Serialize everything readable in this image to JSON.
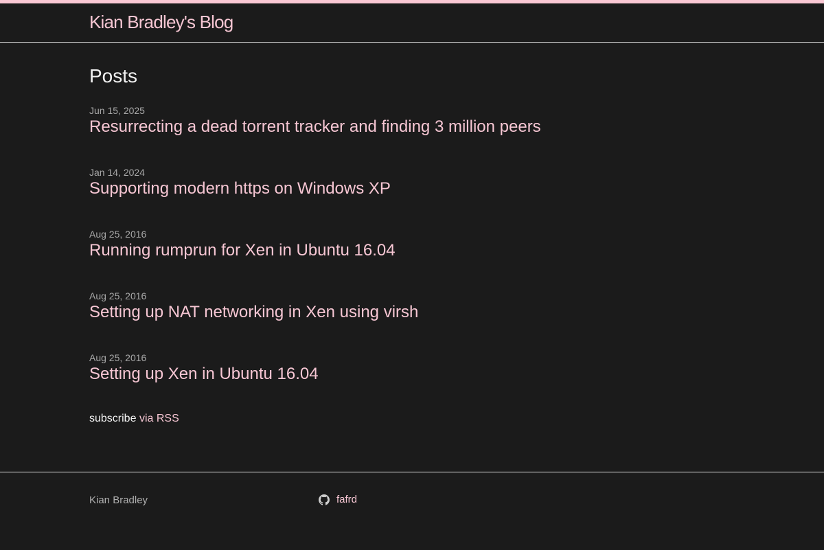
{
  "header": {
    "site_title": "Kian Bradley's Blog"
  },
  "main": {
    "heading": "Posts",
    "posts": [
      {
        "date": "Jun 15, 2025",
        "title": "Resurrecting a dead torrent tracker and finding 3 million peers"
      },
      {
        "date": "Jan 14, 2024",
        "title": "Supporting modern https on Windows XP"
      },
      {
        "date": "Aug 25, 2016",
        "title": "Running rumprun for Xen in Ubuntu 16.04"
      },
      {
        "date": "Aug 25, 2016",
        "title": "Setting up NAT networking in Xen using virsh"
      },
      {
        "date": "Aug 25, 2016",
        "title": "Setting up Xen in Ubuntu 16.04"
      }
    ],
    "subscribe": {
      "prefix": "subscribe",
      "link_label": "via RSS"
    }
  },
  "footer": {
    "author_name": "Kian Bradley",
    "github": {
      "icon": "github-icon",
      "username": "fafrd"
    }
  },
  "colors": {
    "background": "#1b1b1b",
    "accent_pink": "#f6c6d3",
    "top_bar": "#f9c8d4",
    "heading_text": "#f2f2f2",
    "muted_text": "#a9a9a9",
    "divider": "#e0e0e0"
  }
}
